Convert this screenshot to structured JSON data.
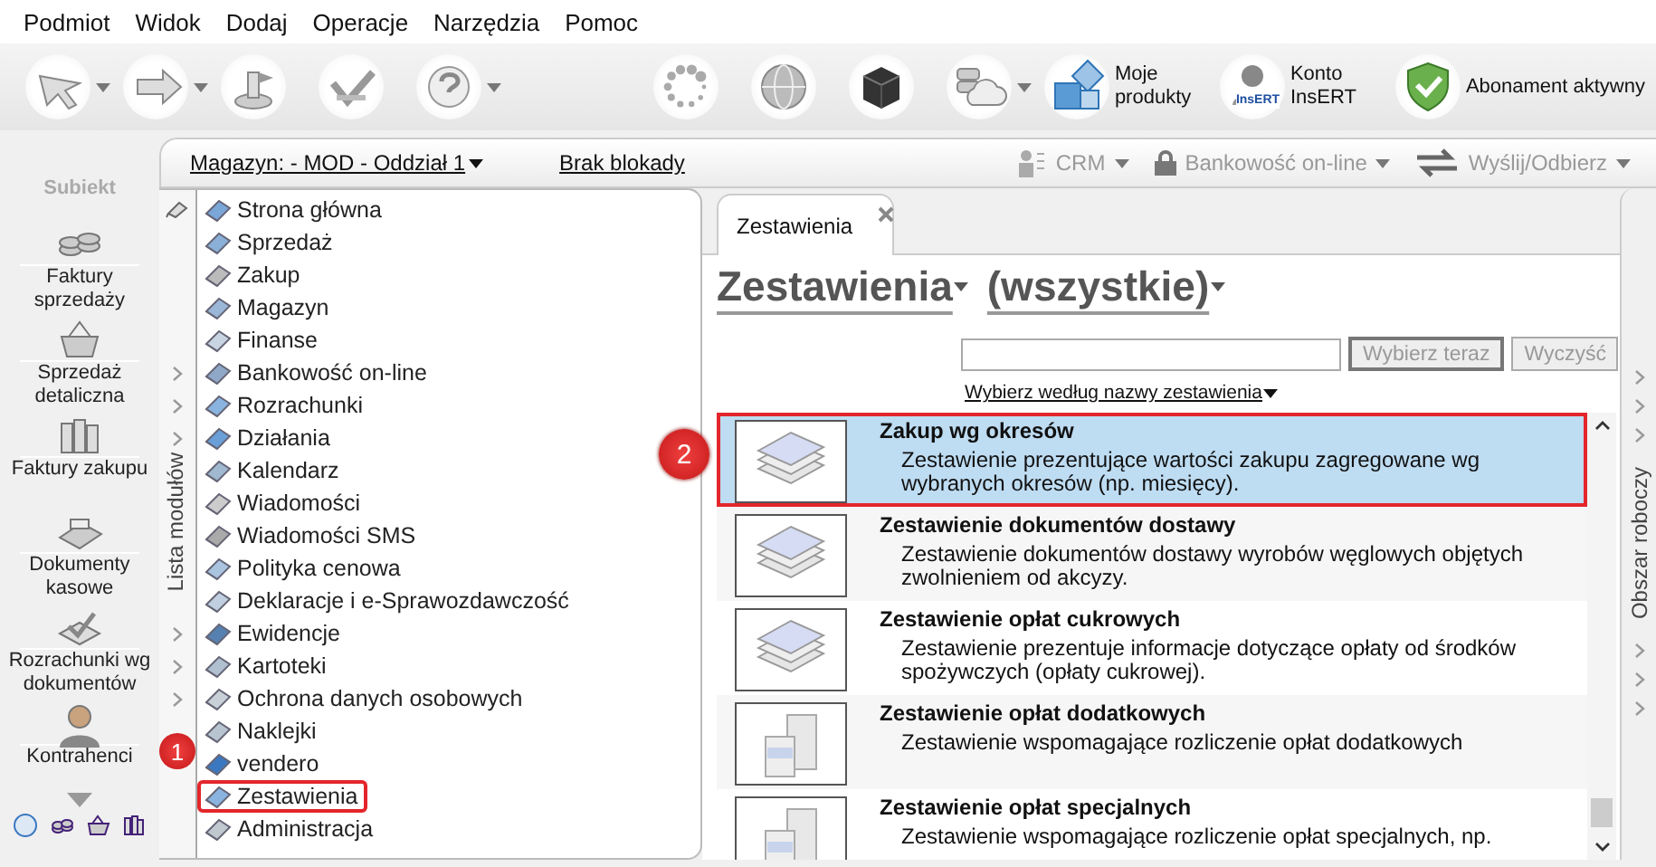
{
  "menu": [
    "Podmiot",
    "Widok",
    "Dodaj",
    "Operacje",
    "Narzędzia",
    "Pomoc"
  ],
  "toolbar": {
    "left_buttons": [
      {
        "kind": "cursor",
        "dropdown": true
      },
      {
        "kind": "arrow",
        "dropdown": true
      },
      {
        "kind": "stamp",
        "dropdown": false
      },
      {
        "kind": "check",
        "dropdown": false
      },
      {
        "kind": "help",
        "dropdown": true
      }
    ],
    "right_buttons": [
      {
        "kind": "spinner",
        "dropdown": false
      },
      {
        "kind": "globe",
        "dropdown": false
      },
      {
        "kind": "cube",
        "dropdown": false
      },
      {
        "kind": "cloud",
        "dropdown": true
      }
    ],
    "links": [
      {
        "label": "Moje produkty",
        "kind": "products"
      },
      {
        "label": "Konto InsERT",
        "kind": "account",
        "badge": "InsERT"
      },
      {
        "label": "Abonament aktywny",
        "kind": "shield"
      }
    ]
  },
  "app": {
    "logo": "Subiekt"
  },
  "nav": {
    "items": [
      {
        "label": "Faktury sprzedaży",
        "kind": "coins"
      },
      {
        "label": "Sprzedaż detaliczna",
        "kind": "basket"
      },
      {
        "label": "Faktury zakupu",
        "kind": "books"
      },
      {
        "label": "Dokumenty kasowe",
        "kind": "register"
      },
      {
        "label": "Rozrachunki wg dokumentów",
        "kind": "check"
      },
      {
        "label": "Kontrahenci",
        "kind": "person"
      }
    ]
  },
  "module_bar": {
    "warehouse": "Magazyn: - MOD - Oddział 1",
    "lock": "Brak blokady",
    "actions": [
      {
        "label": "CRM",
        "kind": "crm"
      },
      {
        "label": "Bankowość on-line",
        "kind": "bank"
      },
      {
        "label": "Wyślij/Odbierz",
        "kind": "sync"
      }
    ]
  },
  "module_list": {
    "title": "Lista modułów",
    "items": [
      {
        "label": "Strona główna",
        "expandable": false,
        "marked": false
      },
      {
        "label": "Sprzedaż",
        "expandable": false,
        "marked": false
      },
      {
        "label": "Zakup",
        "expandable": false,
        "marked": false
      },
      {
        "label": "Magazyn",
        "expandable": false,
        "marked": false
      },
      {
        "label": "Finanse",
        "expandable": false,
        "marked": false
      },
      {
        "label": "Bankowość on-line",
        "expandable": true,
        "marked": false
      },
      {
        "label": "Rozrachunki",
        "expandable": true,
        "marked": false
      },
      {
        "label": "Działania",
        "expandable": true,
        "marked": false
      },
      {
        "label": "Kalendarz",
        "expandable": false,
        "marked": false
      },
      {
        "label": "Wiadomości",
        "expandable": false,
        "marked": false
      },
      {
        "label": "Wiadomości SMS",
        "expandable": false,
        "marked": false
      },
      {
        "label": "Polityka cenowa",
        "expandable": false,
        "marked": false
      },
      {
        "label": "Deklaracje i e-Sprawozdawczość",
        "expandable": false,
        "marked": false
      },
      {
        "label": "Ewidencje",
        "expandable": true,
        "marked": false
      },
      {
        "label": "Kartoteki",
        "expandable": true,
        "marked": false
      },
      {
        "label": "Ochrona danych osobowych",
        "expandable": true,
        "marked": false
      },
      {
        "label": "Naklejki",
        "expandable": false,
        "marked": false
      },
      {
        "label": "vendero",
        "expandable": false,
        "marked": false
      },
      {
        "label": "Zestawienia",
        "expandable": false,
        "marked": true
      },
      {
        "label": "Administracja",
        "expandable": false,
        "marked": false
      }
    ]
  },
  "report_panel": {
    "tab": {
      "label": "Zestawienia",
      "selected": true
    },
    "category": "Zestawienia",
    "filter": "(wszystkie)",
    "buttons": [
      {
        "label": "Wybierz teraz",
        "default": true,
        "disabled": true
      },
      {
        "label": "Wyczyść",
        "default": false,
        "disabled": true
      }
    ],
    "sort_link": "Wybierz według nazwy zestawienia",
    "reports": [
      {
        "title": "Zakup wg okresów",
        "description": "Zestawienie prezentujące wartości zakupu zagregowane wg wybranych okresów (np. miesięcy).",
        "kind": "sheets",
        "selected": true,
        "marked": true
      },
      {
        "title": "Zestawienie dokumentów dostawy",
        "description": "Zestawienie dokumentów dostawy wyrobów węglowych objętych zwolnieniem od akcyzy.",
        "kind": "sheets",
        "selected": false,
        "marked": false
      },
      {
        "title": "Zestawienie opłat cukrowych",
        "description": "Zestawienie prezentuje informacje dotyczące opłaty od środków spożywczych (opłaty cukrowej).",
        "kind": "sheets",
        "selected": false,
        "marked": false
      },
      {
        "title": "Zestawienie opłat dodatkowych",
        "description": "Zestawienie wspomagające rozliczenie opłat dodatkowych",
        "kind": "boxes",
        "selected": false,
        "marked": false
      },
      {
        "title": "Zestawienie opłat specjalnych",
        "description": "Zestawienie wspomagające rozliczenie opłat specjalnych, np.",
        "kind": "boxes",
        "selected": false,
        "marked": false
      }
    ]
  },
  "side_panel": {
    "label": "Obszar roboczy"
  },
  "annotations": [
    {
      "label": "1"
    },
    {
      "label": "2"
    }
  ]
}
